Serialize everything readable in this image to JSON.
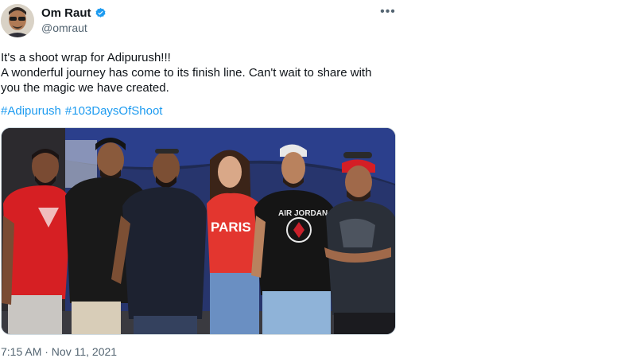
{
  "author": {
    "name": "Om Raut",
    "handle": "@omraut",
    "verified": true,
    "avatar_icon": "profile-photo"
  },
  "menu": {
    "icon": "more-options-icon",
    "label": "•••"
  },
  "tweet": {
    "lines": [
      "It's a shoot wrap for Adipurush!!!",
      "A wonderful journey has come to its finish line. Can't wait to share with",
      "you the magic we have created."
    ],
    "hashtags": [
      "#Adipurush",
      "#103DaysOfShoot"
    ]
  },
  "media": {
    "shirt_texts": {
      "paris": "PARIS",
      "jordan": "AIR JORDAN"
    }
  },
  "meta": {
    "timestamp": "7:15 AM · Nov 11, 2021"
  },
  "colors": {
    "link": "#1d9bf0",
    "verified": "#1d9bf0",
    "secondary": "#536471"
  }
}
